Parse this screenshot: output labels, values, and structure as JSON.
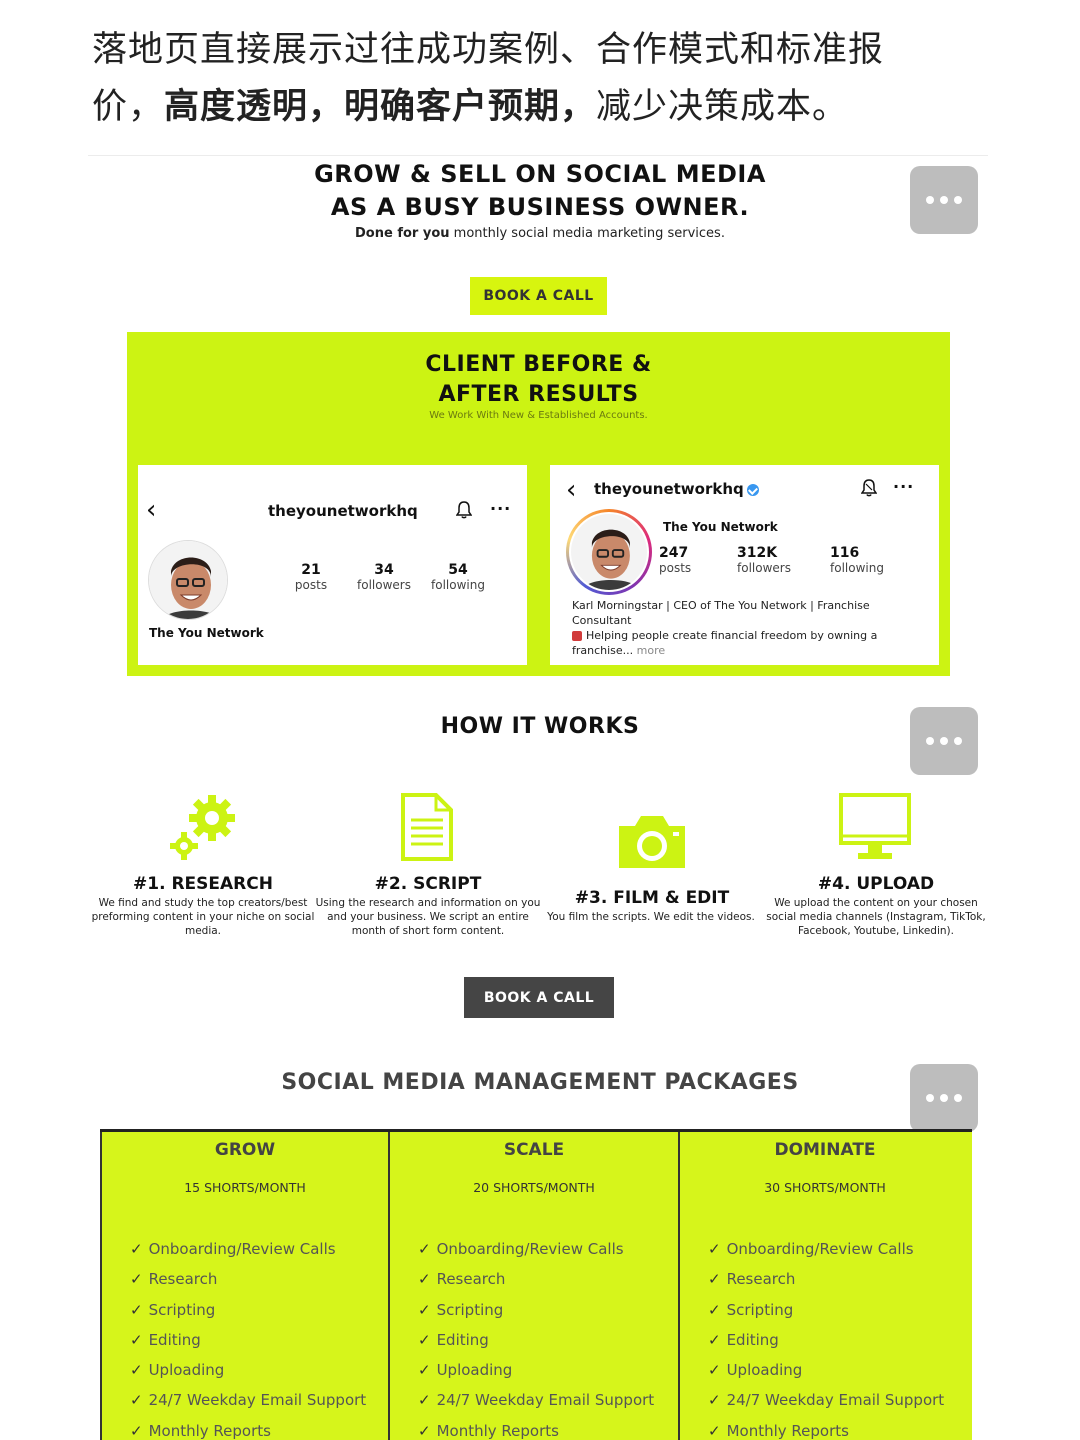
{
  "caption": {
    "line1": "落地页直接展示过往成功案例、合作模式和标准报",
    "line2_pre": "价，",
    "line2_bold": "高度透明，明确客户预期，",
    "line2_post": "减少决策成本。"
  },
  "hero": {
    "title_line1": "GROW & SELL ON SOCIAL MEDIA",
    "title_line2": "AS A BUSY BUSINESS OWNER.",
    "subtitle_bold": "Done for you",
    "subtitle_rest": " monthly social media marketing services.",
    "cta": "BOOK A CALL"
  },
  "results": {
    "title_line1": "CLIENT BEFORE &",
    "title_line2": "AFTER RESULTS",
    "subtitle": "We Work With New & Established Accounts.",
    "before": {
      "handle": "theyounetworkhq",
      "stats": [
        {
          "num": "21",
          "label": "posts"
        },
        {
          "num": "34",
          "label": "followers"
        },
        {
          "num": "54",
          "label": "following"
        }
      ],
      "name": "The You Network"
    },
    "after": {
      "handle": "theyounetworkhq",
      "name": "The You Network",
      "stats": [
        {
          "num": "247",
          "label": "posts"
        },
        {
          "num": "312K",
          "label": "followers"
        },
        {
          "num": "116",
          "label": "following"
        }
      ],
      "bio_line1": "Karl Morningstar | CEO of The You Network | Franchise",
      "bio_line2": "Consultant",
      "bio_line3": "Helping people create financial freedom by owning a",
      "bio_line4": "franchise...",
      "bio_more": " more"
    }
  },
  "how": {
    "title": "HOW IT WORKS",
    "steps": [
      {
        "title": "#1. RESEARCH",
        "desc": "We find and study the top creators/best preforming content in your niche on social media.",
        "icon": "gears-icon"
      },
      {
        "title": "#2. SCRIPT",
        "desc": "Using the research and information on you and your business. We script an entire month of short form content.",
        "icon": "document-icon"
      },
      {
        "title": "#3. FILM & EDIT",
        "desc": "You film the scripts. We edit the videos.",
        "icon": "camera-icon"
      },
      {
        "title": "#4. UPLOAD",
        "desc": "We upload the content on your chosen social media channels (Instagram, TikTok, Facebook, Youtube, Linkedin).",
        "icon": "monitor-icon"
      }
    ],
    "cta": "BOOK A CALL"
  },
  "packages": {
    "title": "SOCIAL MEDIA MANAGEMENT PACKAGES",
    "tiers": [
      {
        "name": "GROW",
        "shorts": "15 SHORTS/MONTH",
        "features": [
          "Onboarding/Review Calls",
          "Research",
          "Scripting",
          "Editing",
          "Uploading",
          "24/7 Weekday Email Support",
          "Monthly Reports"
        ]
      },
      {
        "name": "SCALE",
        "shorts": "20 SHORTS/MONTH",
        "features": [
          "Onboarding/Review Calls",
          "Research",
          "Scripting",
          "Editing",
          "Uploading",
          "24/7 Weekday Email Support",
          "Monthly Reports"
        ]
      },
      {
        "name": "DOMINATE",
        "shorts": "30 SHORTS/MONTH",
        "features": [
          "Onboarding/Review Calls",
          "Research",
          "Scripting",
          "Editing",
          "Uploading",
          "24/7 Weekday Email Support",
          "Monthly Reports"
        ]
      }
    ]
  },
  "colors": {
    "accent_green": "#ccf313",
    "button_dark": "#454545",
    "verified_blue": "#3897f0"
  }
}
